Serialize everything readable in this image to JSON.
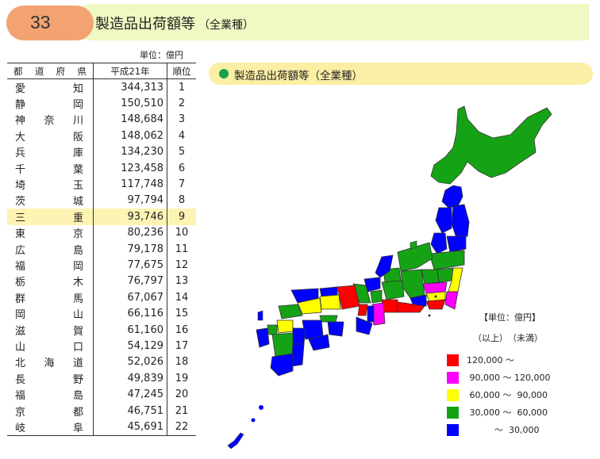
{
  "header": {
    "number": "33",
    "title": "製造品出荷額等",
    "subtitle": "（全業種）"
  },
  "unit_note": "単位：億円",
  "table": {
    "headers": {
      "pref": [
        "都",
        "道",
        "府",
        "県"
      ],
      "value": "平成21年",
      "rank": "順位"
    },
    "rows": [
      {
        "pref": [
          "愛",
          "知"
        ],
        "value": "344,313",
        "rank": "1"
      },
      {
        "pref": [
          "静",
          "岡"
        ],
        "value": "150,510",
        "rank": "2"
      },
      {
        "pref": [
          "神",
          "奈",
          "川"
        ],
        "value": "148,684",
        "rank": "3"
      },
      {
        "pref": [
          "大",
          "阪"
        ],
        "value": "148,062",
        "rank": "4"
      },
      {
        "pref": [
          "兵",
          "庫"
        ],
        "value": "134,230",
        "rank": "5"
      },
      {
        "pref": [
          "千",
          "葉"
        ],
        "value": "123,458",
        "rank": "6"
      },
      {
        "pref": [
          "埼",
          "玉"
        ],
        "value": "117,748",
        "rank": "7"
      },
      {
        "pref": [
          "茨",
          "城"
        ],
        "value": "97,794",
        "rank": "8"
      },
      {
        "pref": [
          "三",
          "重"
        ],
        "value": "93,746",
        "rank": "9",
        "highlight": true
      },
      {
        "pref": [
          "東",
          "京"
        ],
        "value": "80,236",
        "rank": "10"
      },
      {
        "pref": [
          "広",
          "島"
        ],
        "value": "79,178",
        "rank": "11"
      },
      {
        "pref": [
          "福",
          "岡"
        ],
        "value": "77,675",
        "rank": "12"
      },
      {
        "pref": [
          "栃",
          "木"
        ],
        "value": "76,797",
        "rank": "13"
      },
      {
        "pref": [
          "群",
          "馬"
        ],
        "value": "67,067",
        "rank": "14"
      },
      {
        "pref": [
          "岡",
          "山"
        ],
        "value": "66,116",
        "rank": "15"
      },
      {
        "pref": [
          "滋",
          "賀"
        ],
        "value": "61,160",
        "rank": "16"
      },
      {
        "pref": [
          "山",
          "口"
        ],
        "value": "54,129",
        "rank": "17"
      },
      {
        "pref": [
          "北",
          "海",
          "道"
        ],
        "value": "52,026",
        "rank": "18"
      },
      {
        "pref": [
          "長",
          "野"
        ],
        "value": "49,839",
        "rank": "19"
      },
      {
        "pref": [
          "福",
          "島"
        ],
        "value": "47,245",
        "rank": "20"
      },
      {
        "pref": [
          "京",
          "都"
        ],
        "value": "46,751",
        "rank": "21"
      },
      {
        "pref": [
          "岐",
          "阜"
        ],
        "value": "45,691",
        "rank": "22"
      }
    ]
  },
  "map_panel": {
    "title": "製造品出荷額等（全業種）",
    "dot_color": "#14a34a"
  },
  "legend": {
    "title": "【単位：億円】",
    "subtitle": "（以上）　（未満）",
    "items": [
      {
        "label": "120,000 〜",
        "color": "#ff0000"
      },
      {
        "label": " 90,000 〜 120,000",
        "color": "#ff00ff"
      },
      {
        "label": " 60,000 〜  90,000",
        "color": "#ffff00"
      },
      {
        "label": " 30,000 〜  60,000",
        "color": "#15a315"
      },
      {
        "label": "          〜  30,000",
        "color": "#0000ff"
      }
    ]
  },
  "colors": {
    "header_number_bg": "#f2a371",
    "header_title_bg": "#eef9c3",
    "highlight_row": "#fdf4b4",
    "legend_bar_bg": "#fbeea5"
  }
}
